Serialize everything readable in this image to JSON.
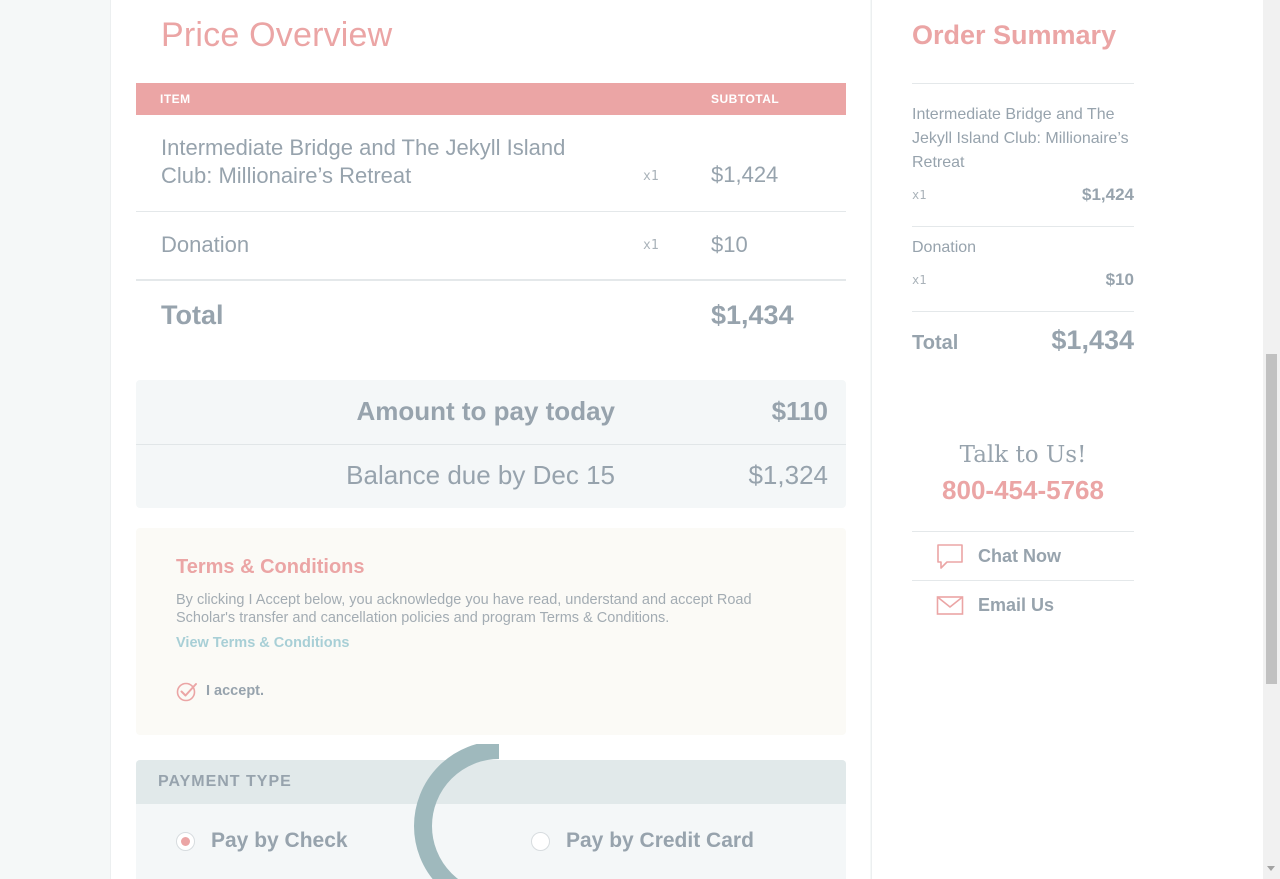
{
  "price_overview": {
    "title": "Price Overview",
    "columns": {
      "item": "ITEM",
      "subtotal": "SUBTOTAL"
    },
    "rows": [
      {
        "name": "Intermediate Bridge and The Jekyll Island Club: Millionaire’s Retreat",
        "qty": "x1",
        "price": "$1,424"
      },
      {
        "name": "Donation",
        "qty": "x1",
        "price": "$10"
      }
    ],
    "total_label": "Total",
    "total_value": "$1,434"
  },
  "payment_summary": {
    "today_label": "Amount to pay today",
    "today_value": "$110",
    "balance_label": "Balance due by Dec 15",
    "balance_value": "$1,324"
  },
  "terms": {
    "title": "Terms & Conditions",
    "body": "By clicking I Accept below, you acknowledge you have read, understand and accept Road Scholar's transfer and cancellation policies and program Terms & Conditions.",
    "link": "View Terms & Conditions",
    "accept_label": "I accept.",
    "accepted": true
  },
  "payment_type": {
    "header": "PAYMENT TYPE",
    "options": [
      {
        "label": "Pay by Check",
        "selected": true
      },
      {
        "label": "Pay by Credit Card",
        "selected": false
      }
    ]
  },
  "order_summary": {
    "title": "Order Summary",
    "items": [
      {
        "name": "Intermediate Bridge and The Jekyll Island Club: Millionaire’s Retreat",
        "qty": "x1",
        "price": "$1,424"
      },
      {
        "name": "Donation",
        "qty": "x1",
        "price": "$10"
      }
    ],
    "total_label": "Total",
    "total_value": "$1,434"
  },
  "contact": {
    "talk_label": "Talk to Us!",
    "phone": "800-454-5768",
    "chat_label": "Chat Now",
    "email_label": "Email Us"
  },
  "colors": {
    "accent": "#eba5a5",
    "text": "#97a3ad",
    "link": "#a8cfd6",
    "spinner": "#9fb9bd"
  },
  "icons": {
    "check": "check-circle-icon",
    "chat": "chat-bubble-icon",
    "email": "envelope-icon"
  }
}
